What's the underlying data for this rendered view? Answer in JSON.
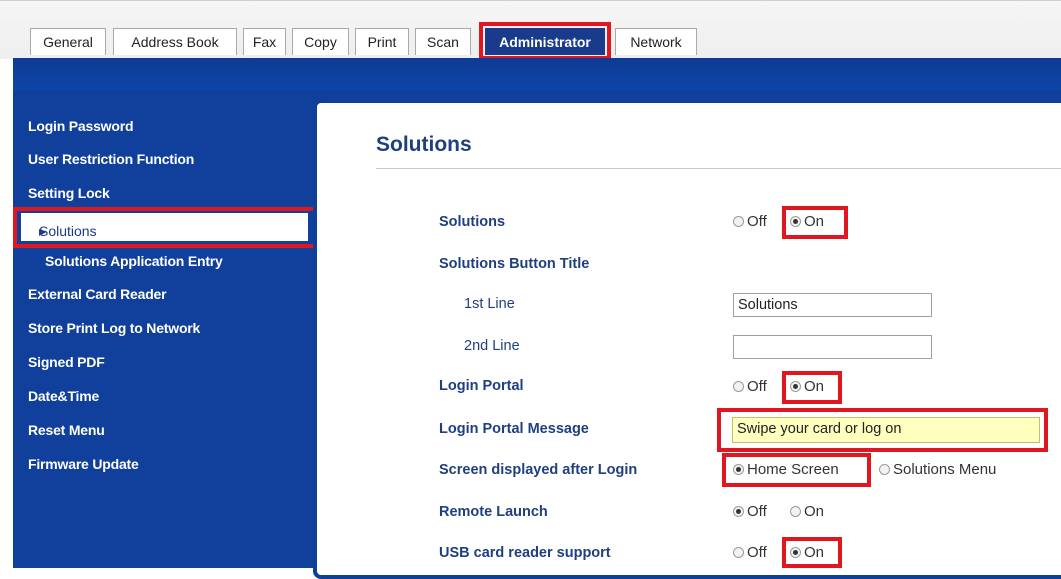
{
  "tabs": [
    "General",
    "Address Book",
    "Fax",
    "Copy",
    "Print",
    "Scan",
    "Administrator",
    "Network"
  ],
  "active_tab": "Administrator",
  "sidebar": {
    "items": [
      "Login Password",
      "User Restriction Function",
      "Setting Lock",
      "Solutions",
      "Solutions Application Entry",
      "External Card Reader",
      "Store Print Log to Network",
      "Signed PDF",
      "Date&Time",
      "Reset Menu",
      "Firmware Update"
    ],
    "selected": "Solutions",
    "selected_marker": "▸"
  },
  "page": {
    "title": "Solutions",
    "rows": {
      "solutions": {
        "label": "Solutions",
        "off": "Off",
        "on": "On",
        "value": "On"
      },
      "button_title": {
        "label": "Solutions Button Title"
      },
      "line1": {
        "label": "1st Line",
        "value": "Solutions"
      },
      "line2": {
        "label": "2nd Line",
        "value": ""
      },
      "login_portal": {
        "label": "Login Portal",
        "off": "Off",
        "on": "On",
        "value": "On"
      },
      "portal_message": {
        "label": "Login Portal Message",
        "value": "Swipe your card or log on"
      },
      "screen_after_login": {
        "label": "Screen displayed after Login",
        "opt1": "Home Screen",
        "opt2": "Solutions Menu",
        "value": "Home Screen"
      },
      "remote_launch": {
        "label": "Remote Launch",
        "off": "Off",
        "on": "On",
        "value": "Off"
      },
      "usb_card_reader": {
        "label": "USB card reader support",
        "off": "Off",
        "on": "On",
        "value": "On"
      }
    }
  },
  "colors": {
    "accent_blue": "#103f9c",
    "highlight_red": "#e1161e",
    "title_blue": "#1f3f7f",
    "message_bg": "#ffffbf"
  }
}
